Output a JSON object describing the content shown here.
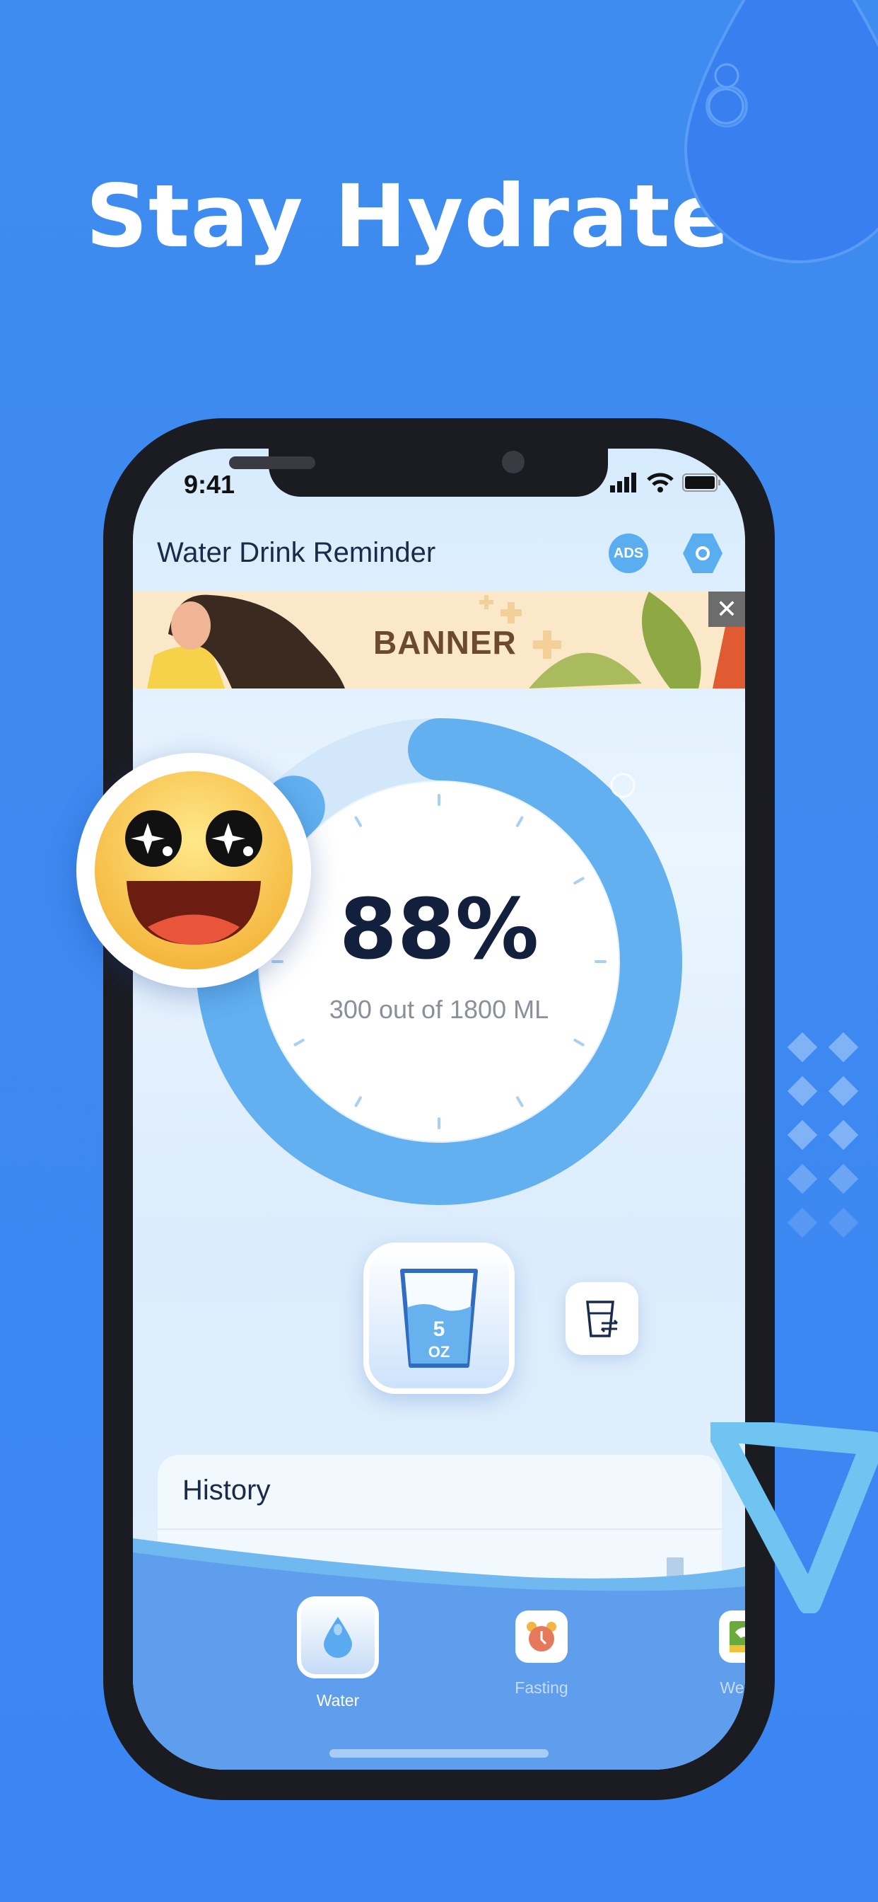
{
  "headline": "Stay Hydrated",
  "status_bar": {
    "time": "9:41"
  },
  "header": {
    "title": "Water Drink Reminder",
    "ads_icon": "ADS"
  },
  "banner": {
    "text": "BANNER",
    "close": "✕"
  },
  "progress": {
    "percent_label": "88%",
    "percent": 88,
    "amount": "300 out of 1800 ML"
  },
  "cup": {
    "size_value": "5",
    "size_unit": "OZ"
  },
  "history": {
    "title": "History"
  },
  "tabs": [
    {
      "label": "Water",
      "active": true
    },
    {
      "label": "Fasting",
      "active": false
    },
    {
      "label": "Weight",
      "active": false
    }
  ],
  "colors": {
    "background": "#3f8cf0",
    "ring": "#62b0ef",
    "title": "#13203d"
  }
}
